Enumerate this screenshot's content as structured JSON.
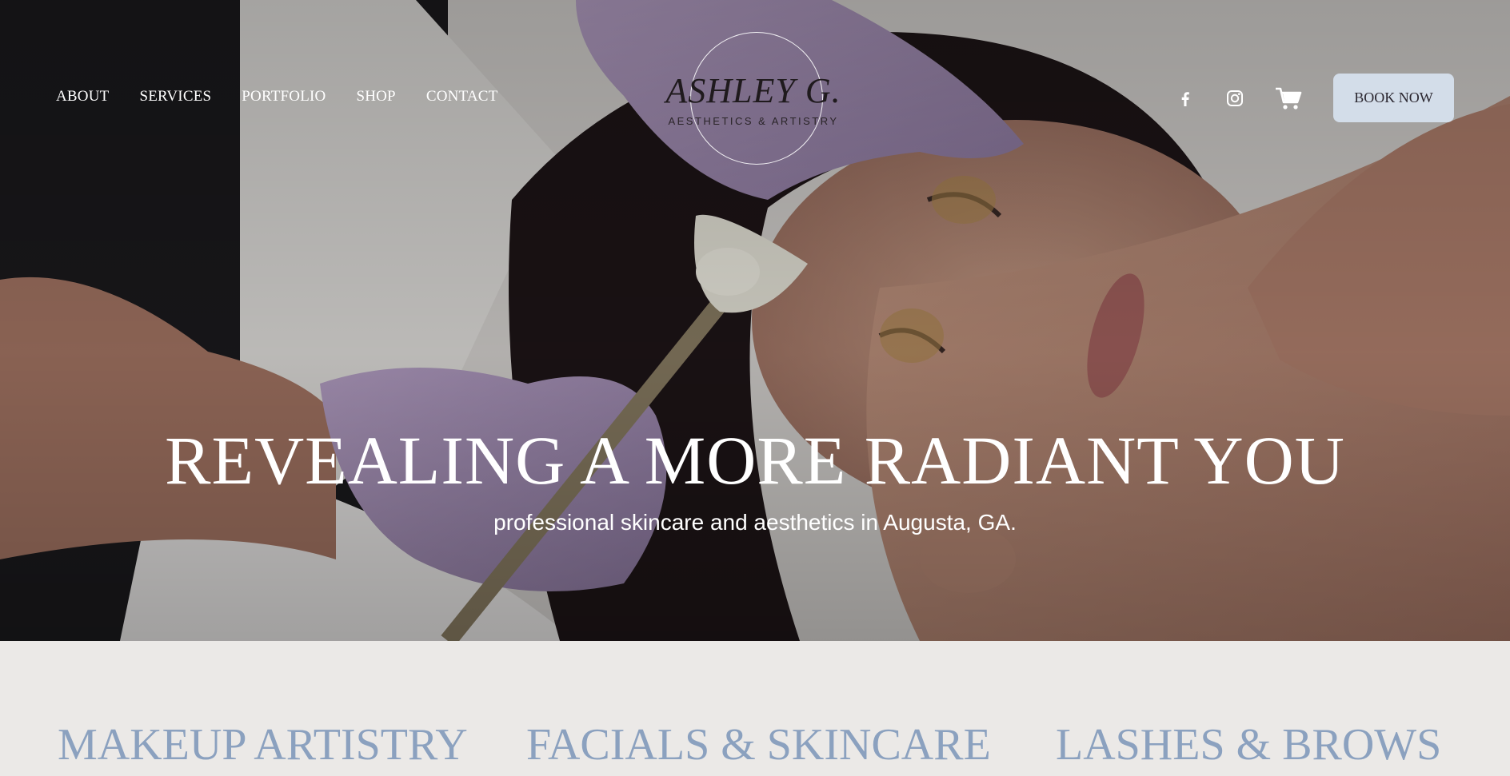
{
  "header": {
    "nav": [
      {
        "label": "ABOUT"
      },
      {
        "label": "SERVICES"
      },
      {
        "label": "PORTFOLIO"
      },
      {
        "label": "SHOP"
      },
      {
        "label": "CONTACT"
      }
    ],
    "logo": {
      "name": "ASHLEY G.",
      "tagline": "AESTHETICS & ARTISTRY"
    },
    "social_icons": [
      "facebook-icon",
      "instagram-icon",
      "cart-icon"
    ],
    "book_label": "BOOK NOW",
    "book_color": "#d3dde9"
  },
  "hero": {
    "headline": "REVEALING A MORE RADIANT YOU",
    "subline": "professional skincare and aesthetics in Augusta, GA."
  },
  "services": [
    {
      "label": "MAKEUP ARTISTRY"
    },
    {
      "label": "FACIALS & SKINCARE"
    },
    {
      "label": "LASHES & BROWS"
    }
  ],
  "colors": {
    "service_heading": "#8ba1bf",
    "section_bg": "#ebe9e7"
  }
}
